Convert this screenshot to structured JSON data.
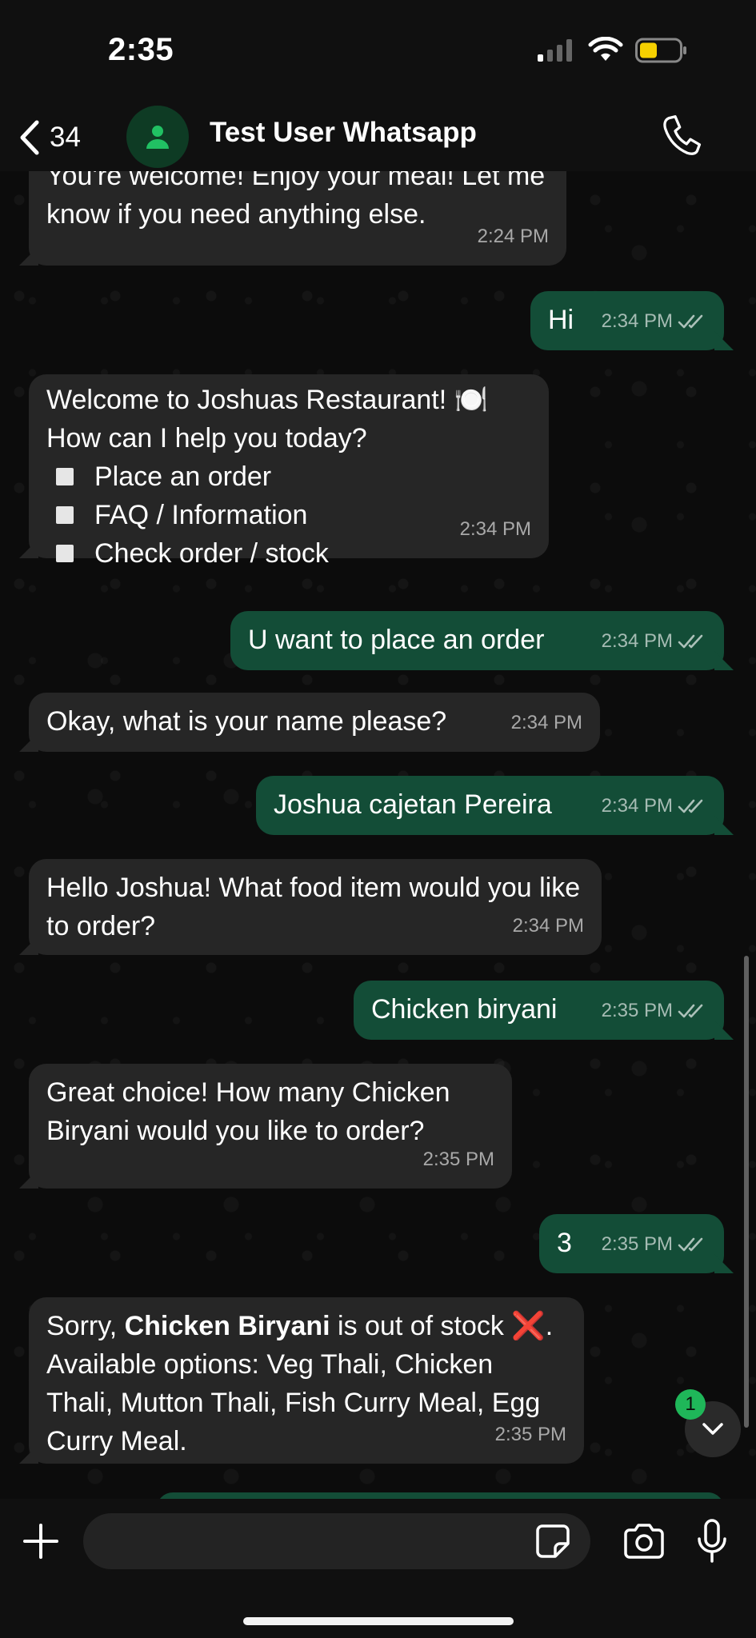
{
  "status_bar": {
    "time": "2:35"
  },
  "header": {
    "back_count": "34",
    "contact_name": "Test User Whatsapp"
  },
  "messages": {
    "m0": {
      "text": "You're welcome! Enjoy your meal! Let me know if you need anything else.",
      "time": "2:24 PM"
    },
    "m1": {
      "text": "Hi",
      "time": "2:34 PM"
    },
    "m2": {
      "line1": "Welcome to Joshuas Restaurant! 🍽️",
      "line2": "How can I help you today?",
      "options": [
        "Place an order",
        "FAQ / Information",
        "Check order / stock"
      ],
      "time": "2:34 PM"
    },
    "m3": {
      "text": "U want to place an order",
      "time": "2:34 PM"
    },
    "m4": {
      "text": "Okay, what is your name please?",
      "time": "2:34 PM"
    },
    "m5": {
      "text": "Joshua cajetan Pereira",
      "time": "2:34 PM"
    },
    "m6": {
      "text": "Hello Joshua! What food item would you like to order?",
      "time": "2:34 PM"
    },
    "m7": {
      "text": "Chicken biryani",
      "time": "2:35 PM"
    },
    "m8": {
      "text": "Great choice! How many Chicken Biryani would you like to order?",
      "time": "2:35 PM"
    },
    "m9": {
      "text": "3",
      "time": "2:35 PM"
    },
    "m10": {
      "prefix": "Sorry, ",
      "bold": "Chicken Biryani",
      "rest_line1": " is out of stock",
      "emoji": "❌",
      "rest": ". Available options: Veg Thali, Chicken Thali, Mutton Thali, Fish Curry Meal, Egg Curry Meal.",
      "time": "2:35 PM"
    }
  },
  "unread_count": "1",
  "composer": {
    "value": ""
  },
  "icons": {
    "back": "chevron-left-icon",
    "avatar": "person-icon",
    "call": "phone-icon",
    "plus": "plus-icon",
    "sticker": "sticker-icon",
    "camera": "camera-icon",
    "mic": "microphone-icon",
    "scroll_down": "chevron-down-icon",
    "read": "double-check-icon"
  },
  "colors": {
    "incoming_bubble": "#262626",
    "outgoing_bubble": "#134d37",
    "accent": "#1fb759"
  }
}
